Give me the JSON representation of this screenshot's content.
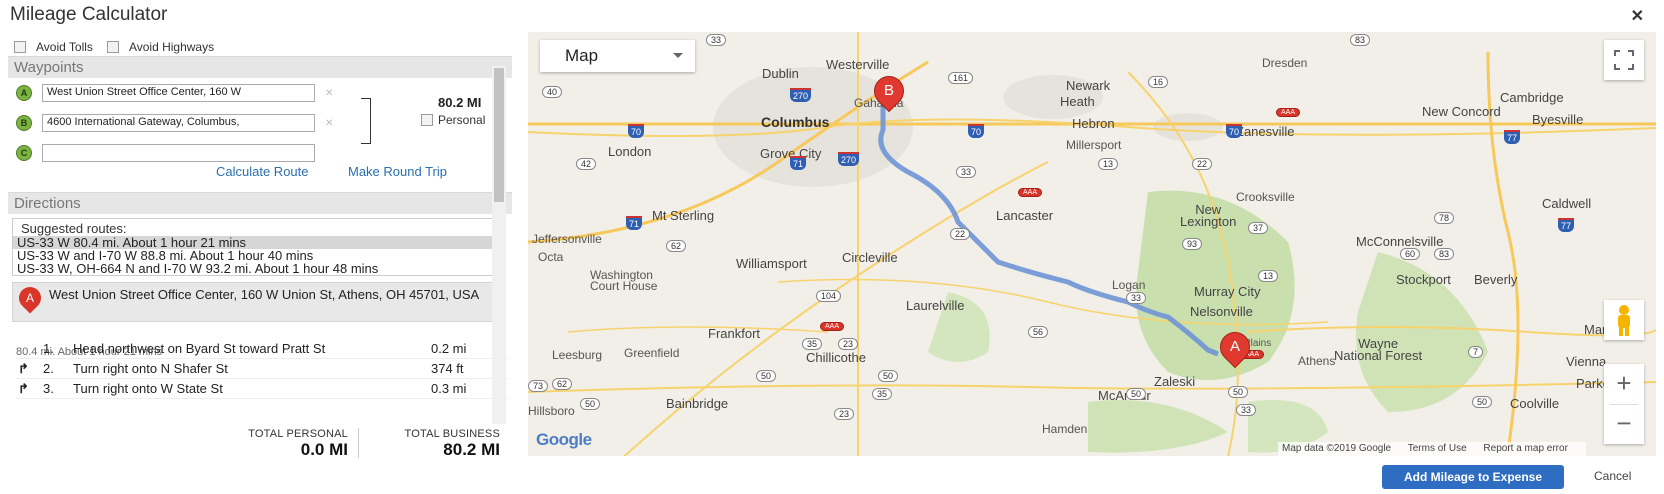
{
  "window": {
    "title": "Mileage Calculator",
    "close": "✕"
  },
  "options": {
    "avoid_tolls": "Avoid Tolls",
    "avoid_highways": "Avoid Highways"
  },
  "waypoints": {
    "header": "Waypoints",
    "items": [
      {
        "badge": "A",
        "value": "West Union Street Office Center, 160 W"
      },
      {
        "badge": "B",
        "value": "4600 International Gateway, Columbus,"
      },
      {
        "badge": "C",
        "value": ""
      }
    ],
    "remove": "✕",
    "total_miles": "80.2 MI",
    "personal_label": "Personal",
    "calculate_route": "Calculate Route",
    "make_round_trip": "Make Round Trip"
  },
  "directions": {
    "header": "Directions",
    "suggested_label": "Suggested routes:",
    "routes": [
      "US-33 W 80.4 mi. About 1 hour 21 mins",
      "US-33 W and I-70 W 88.8 mi. About 1 hour 40 mins",
      "US-33 W, OH-664 N and I-70 W 93.2 mi. About 1 hour 48 mins"
    ],
    "start": {
      "badge": "A",
      "address": "West Union Street Office Center, 160 W Union St, Athens, OH 45701, USA"
    },
    "summary": "80.4 mi. About 1 hour 21 mins",
    "steps": [
      {
        "arrow": "",
        "num": "1.",
        "text": "Head northwest on Byard St toward Pratt St",
        "dist": "0.2 mi"
      },
      {
        "arrow": "↱",
        "num": "2.",
        "text": "Turn right onto N Shafer St",
        "dist": "374 ft"
      },
      {
        "arrow": "↱",
        "num": "3.",
        "text": "Turn right onto W State St",
        "dist": "0.3 mi"
      }
    ]
  },
  "totals": {
    "personal_label": "TOTAL PERSONAL",
    "personal_value": "0.0 MI",
    "business_label": "TOTAL BUSINESS",
    "business_value": "80.2 MI"
  },
  "map": {
    "type": "Map",
    "google": "Google",
    "attribution": "Map data ©2019 Google",
    "terms": "Terms of Use",
    "report": "Report a map error",
    "zoom_in": "+",
    "zoom_out": "−",
    "markers": {
      "a": "A",
      "b": "B"
    },
    "labels": {
      "columbus": "Columbus",
      "dublin": "Dublin",
      "westerville": "Westerville",
      "gahanna": "Gahanna",
      "newark": "Newark",
      "heath": "Heath",
      "hebron": "Hebron",
      "zanesville": "Zanesville",
      "dresden": "Dresden",
      "cambridge": "Cambridge",
      "new_concord": "New Concord",
      "byesville": "Byesville",
      "london": "London",
      "grove_city": "Grove City",
      "millersport": "Millersport",
      "crooksville": "Crooksville",
      "caldwell": "Caldwell",
      "mt_sterling": "Mt Sterling",
      "lancaster": "Lancaster",
      "new_lexington": "New\nLexington",
      "jeffersonville": "Jeffersonville",
      "mcconnelsville": "McConnelsville",
      "octa": "Octa",
      "williamsport": "Williamsport",
      "circleville": "Circleville",
      "washington_ch": "Washington\nCourt House",
      "stockport": "Stockport",
      "beverly": "Beverly",
      "logan": "Logan",
      "murray_city": "Murray City",
      "laurelville": "Laurelville",
      "nelsonville": "Nelsonville",
      "frankfort": "Frankfort",
      "marietta": "Marietta",
      "chillicothe": "Chillicothe",
      "wayne": "Wayne\nNational Forest",
      "leesburg": "Leesburg",
      "greenfield": "Greenfield",
      "the_plains": "The Plains",
      "athens": "Athens",
      "vienna": "Vienna",
      "zaleski": "Zaleski",
      "mcarthur": "McArthur",
      "parkersburg": "Parkersbur",
      "bainbridge": "Bainbridge",
      "coolville": "Coolville",
      "hillsboro": "Hillsboro",
      "hamden": "Hamden"
    },
    "route_color": "#6f95d6"
  },
  "footer": {
    "add": "Add Mileage to Expense",
    "cancel": "Cancel"
  }
}
